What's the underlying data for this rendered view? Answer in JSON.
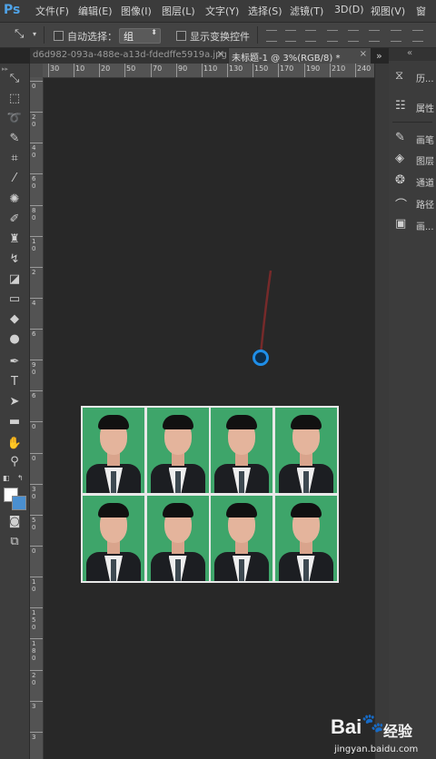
{
  "app": {
    "logo": "Ps"
  },
  "menubar": {
    "items": [
      "文件(F)",
      "编辑(E)",
      "图像(I)",
      "图层(L)",
      "文字(Y)",
      "选择(S)",
      "滤镜(T)",
      "3D(D)",
      "视图(V)",
      "窗"
    ]
  },
  "options": {
    "auto_select_label": "自动选择：",
    "group_value": "组",
    "show_transform_label": "显示变换控件"
  },
  "tabs": [
    {
      "label": "d6d982-093a-488e-a13d-fdedffe5919a.jpg",
      "close": "×"
    },
    {
      "label": "未标题-1 @ 3%(RGB/8) *",
      "close": "×"
    }
  ],
  "tab_overflow": "»",
  "ruler": {
    "h_ticks": [
      "30",
      "10",
      "20",
      "50",
      "70",
      "90",
      "110",
      "130",
      "150",
      "170",
      "190",
      "210",
      "240"
    ],
    "v_ticks": [
      "0",
      "2 0",
      "4 0",
      "6 0",
      "8 0",
      "1 0",
      "2",
      "4",
      "6",
      "9 0",
      "6",
      "0",
      "0",
      "3 0",
      "5 0",
      "0",
      "1 0",
      "1 5 0",
      "1 8 0",
      "2 0",
      "3",
      "3"
    ]
  },
  "panels": [
    {
      "icon": "history-icon",
      "label": "历..."
    },
    {
      "icon": "properties-icon",
      "label": "属性"
    },
    {
      "icon": "brush-icon",
      "label": "画笔"
    },
    {
      "icon": "layers-icon",
      "label": "图层"
    },
    {
      "icon": "channels-icon",
      "label": "通道"
    },
    {
      "icon": "paths-icon",
      "label": "路径"
    },
    {
      "icon": "picture-icon",
      "label": "画..."
    }
  ],
  "colors": {
    "foreground": "#ffffff",
    "background": "#4a8fd0",
    "photo_bg": "#3ea56a"
  },
  "photo_sheet": {
    "rows": 2,
    "cols": 4
  },
  "watermark": {
    "brand": "Bai",
    "brand2": "du",
    "cn": "经验",
    "url": "jingyan.baidu.com"
  }
}
